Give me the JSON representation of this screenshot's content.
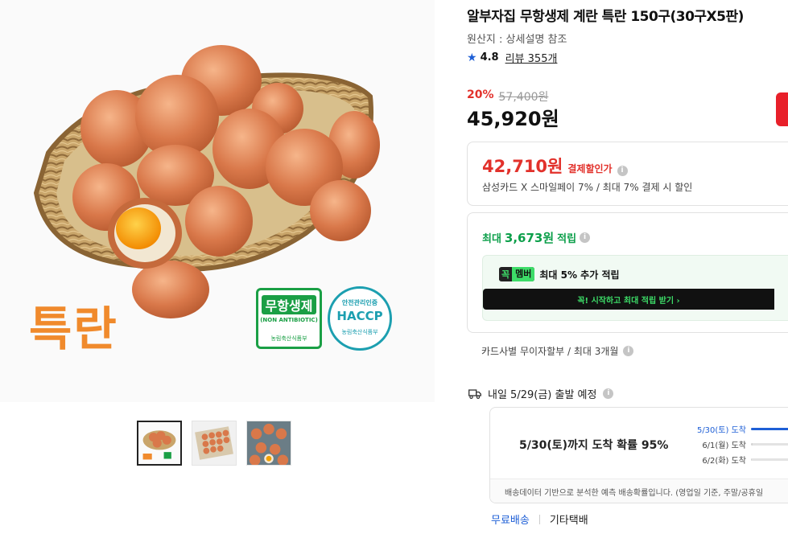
{
  "product": {
    "title": "알부자집 무항생제 계란 특란 150구(30구X5판)",
    "origin": "원산지 : 상세설명 참조",
    "rating": "4.8",
    "review_link": "리뷰 355개"
  },
  "image": {
    "grade_label": "특란",
    "cert_badge": {
      "title": "무항생제",
      "subtitle": "(NON ANTIBIOTIC)",
      "agency": "농림축산식품부"
    },
    "haccp_badge": {
      "top": "안전관리인증",
      "title": "HACCP",
      "agency": "농림축산식품부"
    },
    "thumbnails": [
      "thumb-1",
      "thumb-2",
      "thumb-3"
    ]
  },
  "pricing": {
    "discount_rate": "20%",
    "original_price": "57,400원",
    "sale_price": "45,920원"
  },
  "payment_discount": {
    "amount": "42,710원",
    "label": "결제할인가",
    "description": "삼성카드 X 스마일페이 7% / 최대 7% 결제 시 할인"
  },
  "points": {
    "prefix": "최대",
    "amount": "3,673원",
    "suffix": "적립",
    "member_badge_left": "꼭",
    "member_badge_right": "멤버",
    "member_text": "최대 5% 추가 적립",
    "member_cta": "꼭! 시작하고 최대 적립 받기 ›"
  },
  "installment": "카드사별 무이자할부 / 최대 3개월",
  "shipping": {
    "departure": "내일 5/29(금) 출발 예정",
    "probability": "5/30(토)까지 도착 확률 95%",
    "dates": [
      {
        "label": "5/30(토) 도착",
        "pct": 95
      },
      {
        "label": "6/1(월) 도착",
        "pct": 4
      },
      {
        "label": "6/2(화) 도착",
        "pct": 1
      }
    ],
    "note": "배송데이터 기반으로 분석한 예측 배송확률입니다. (영업일 기준, 주말/공휴일",
    "tab_free": "무료배송",
    "tab_courier": "기타택배"
  },
  "colors": {
    "accent_red": "#e2312b",
    "points_green": "#0c9f4a",
    "link_blue": "#1e5fd6",
    "grade_orange": "#f08a2c"
  }
}
